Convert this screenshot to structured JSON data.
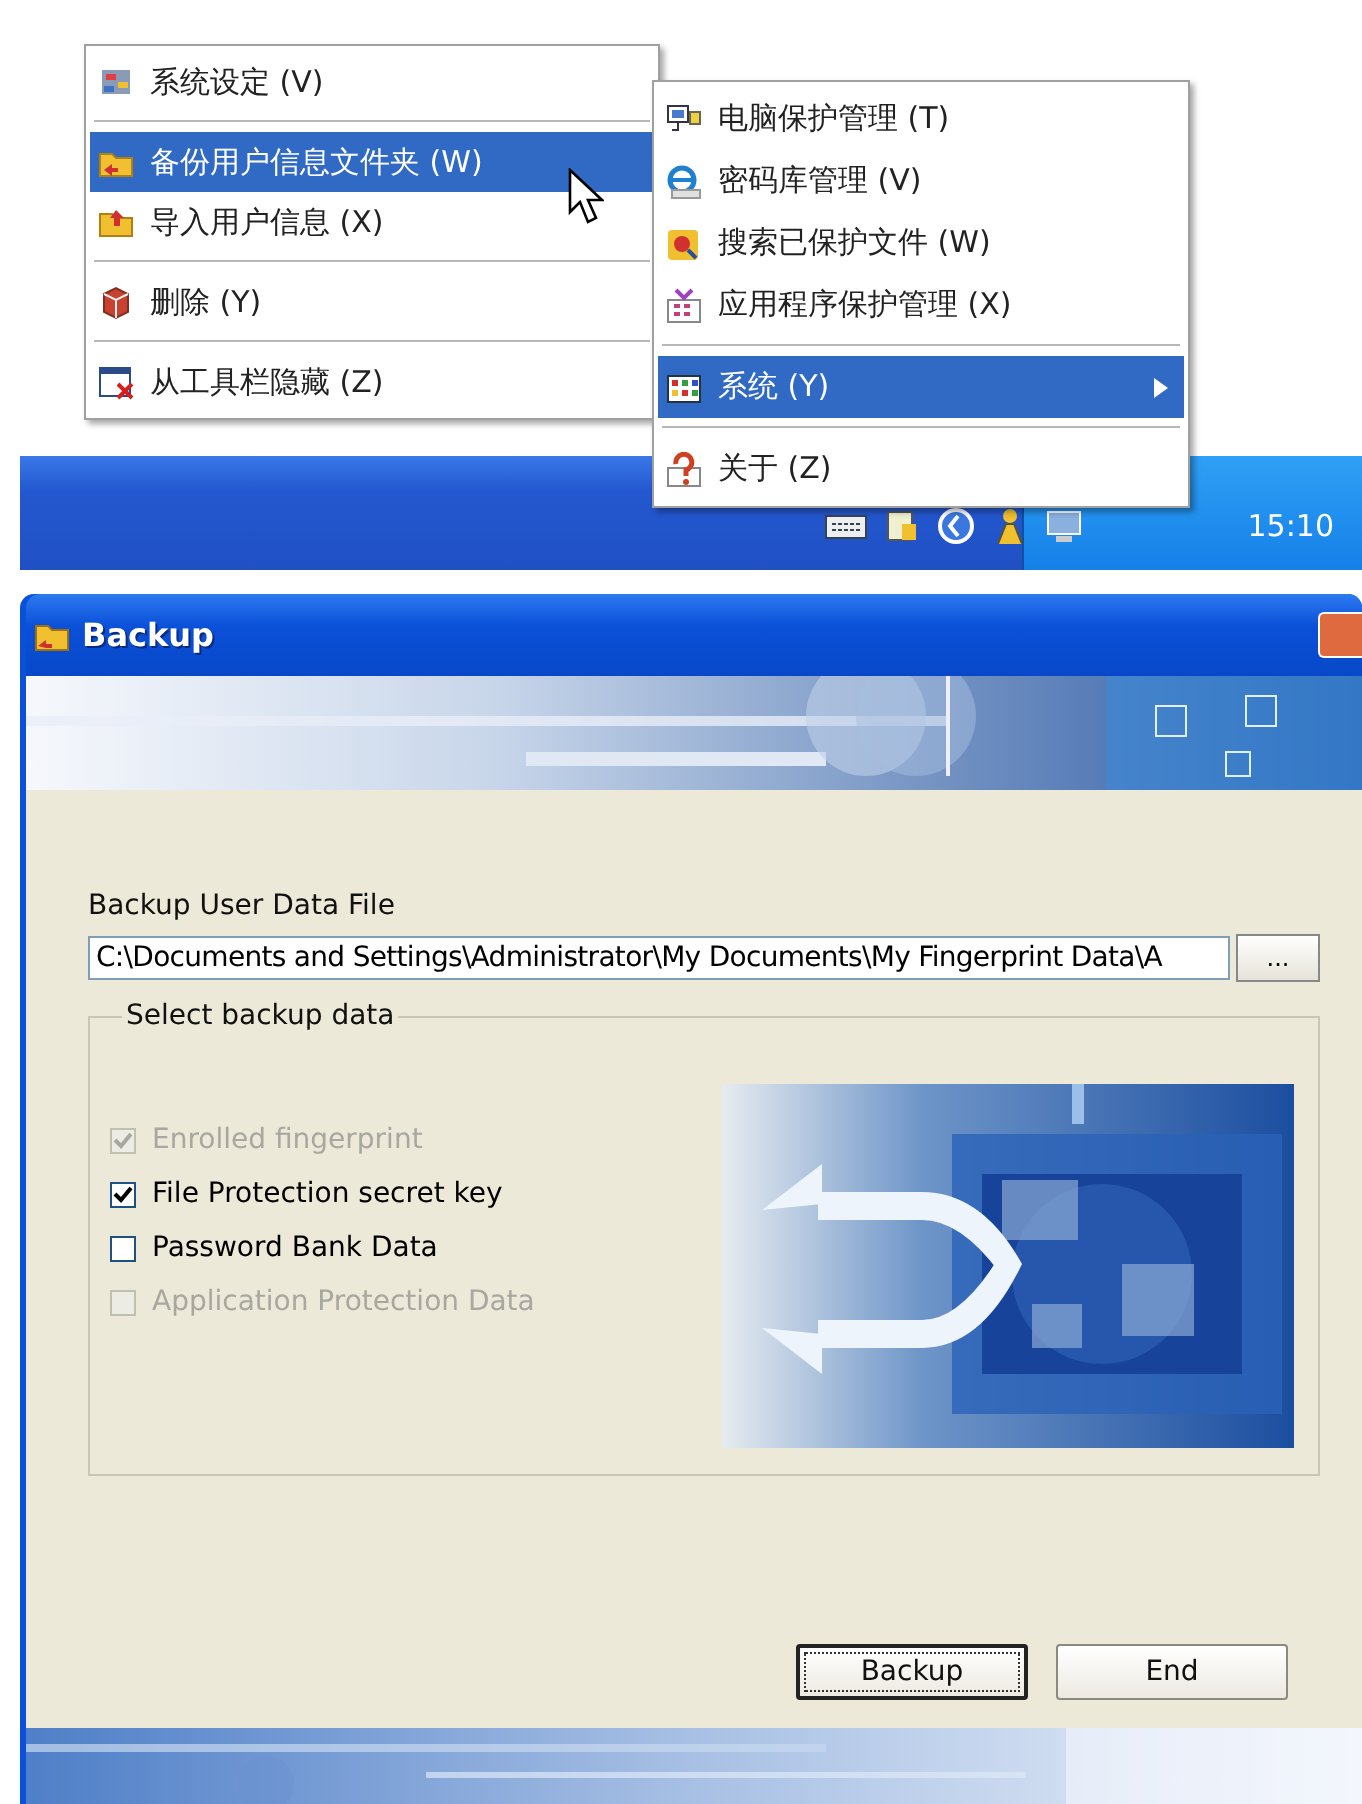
{
  "context_menu": {
    "groups": [
      [
        {
          "label": "系统设定 (V)",
          "selected": false
        }
      ],
      [
        {
          "label": "备份用户信息文件夹 (W)",
          "selected": true
        },
        {
          "label": "导入用户信息 (X)",
          "selected": false
        }
      ],
      [
        {
          "label": "删除 (Y)",
          "selected": false
        }
      ],
      [
        {
          "label": "从工具栏隐藏 (Z)",
          "selected": false
        }
      ]
    ]
  },
  "tray_menu": {
    "groups": [
      [
        {
          "label": "电脑保护管理 (T)",
          "selected": false,
          "has_submenu": false
        },
        {
          "label": "密码库管理 (V)",
          "selected": false,
          "has_submenu": false
        },
        {
          "label": "搜索已保护文件 (W)",
          "selected": false,
          "has_submenu": false
        },
        {
          "label": "应用程序保护管理 (X)",
          "selected": false,
          "has_submenu": false
        }
      ],
      [
        {
          "label": "系统 (Y)",
          "selected": true,
          "has_submenu": true
        }
      ],
      [
        {
          "label": "关于 (Z)",
          "selected": false,
          "has_submenu": false
        }
      ]
    ]
  },
  "taskbar": {
    "clock": "15:10"
  },
  "dialog": {
    "title": "Backup",
    "file_label": "Backup User Data File",
    "file_path": "C:\\Documents and Settings\\Administrator\\My Documents\\My Fingerprint Data\\A",
    "browse_button": "...",
    "group_title": "Select backup data",
    "options": [
      {
        "label": "Enrolled fingerprint",
        "checked": true,
        "disabled": true
      },
      {
        "label": "File Protection secret key",
        "checked": true,
        "disabled": false
      },
      {
        "label": "Password Bank Data",
        "checked": false,
        "disabled": false
      },
      {
        "label": "Application Protection Data",
        "checked": false,
        "disabled": true
      }
    ],
    "buttons": [
      {
        "label": "Backup",
        "default": true
      },
      {
        "label": "End",
        "default": false
      }
    ]
  }
}
